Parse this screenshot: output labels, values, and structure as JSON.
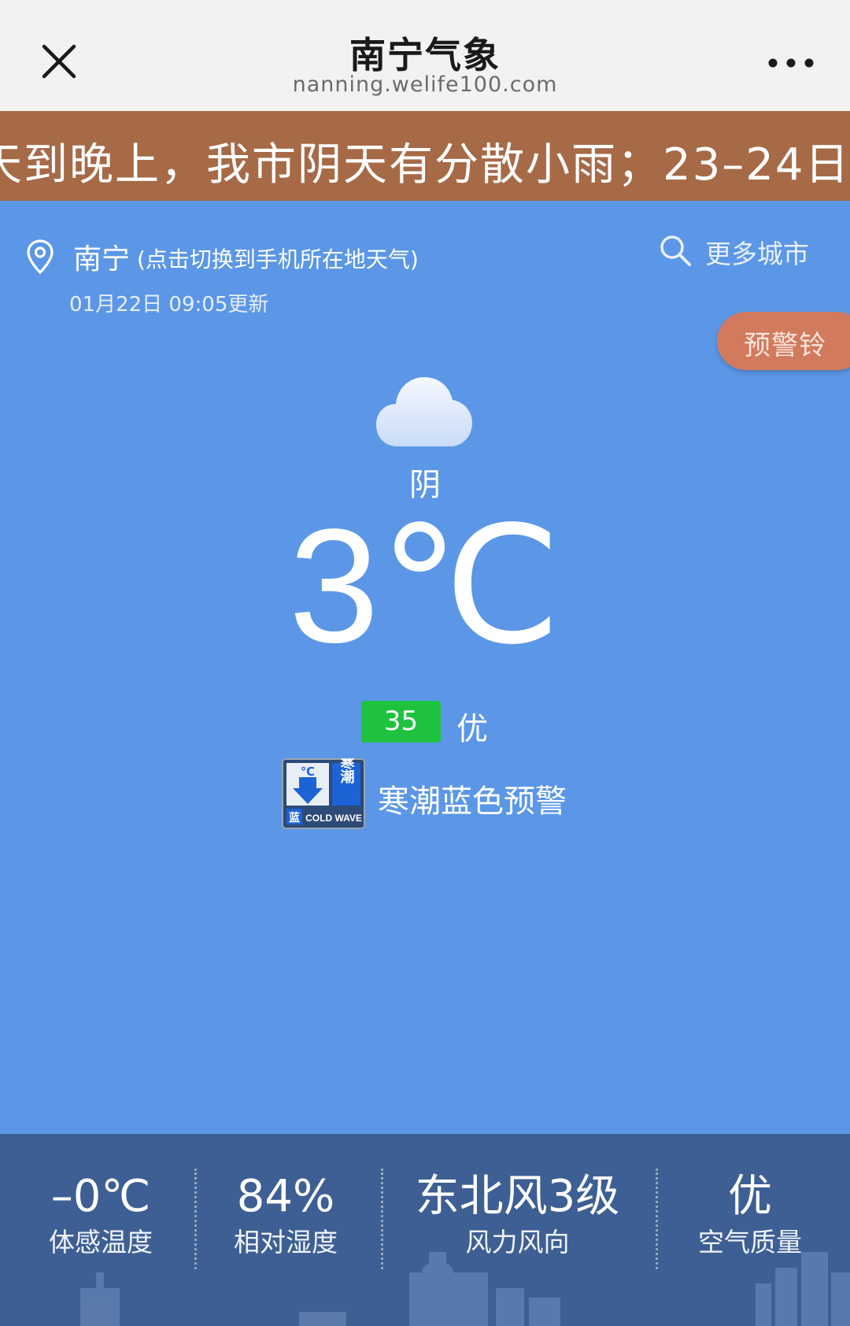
{
  "header": {
    "title": "南宁气象",
    "subtitle": "nanning.welife100.com"
  },
  "marquee": {
    "text": "天到晚上，我市阴天有分散小雨；23–24日"
  },
  "location": {
    "city": "南宁",
    "hint": "(点击切换到手机所在地天气)",
    "updated": "01月22日 09:05更新",
    "more_cities": "更多城市"
  },
  "alarm_button": "预警铃",
  "weather": {
    "condition": "阴",
    "temperature": "3℃",
    "aqi_value": "35",
    "aqi_level": "优",
    "warning": "寒潮蓝色预警"
  },
  "warning_icon": {
    "unit": "℃",
    "chars": "寒潮",
    "color_char": "蓝",
    "english": "COLD WAVE"
  },
  "stats": [
    {
      "value": "–0℃",
      "label": "体感温度"
    },
    {
      "value": "84%",
      "label": "相对湿度"
    },
    {
      "value": "东北风3级",
      "label": "风力风向"
    },
    {
      "value": "优",
      "label": "空气质量"
    }
  ],
  "colors": {
    "background": "#5b97e6",
    "marquee": "#a66a47",
    "alarm": "#d27a5d",
    "aqi_good": "#1ec23f",
    "bottom_panel": "#3e5f93"
  }
}
